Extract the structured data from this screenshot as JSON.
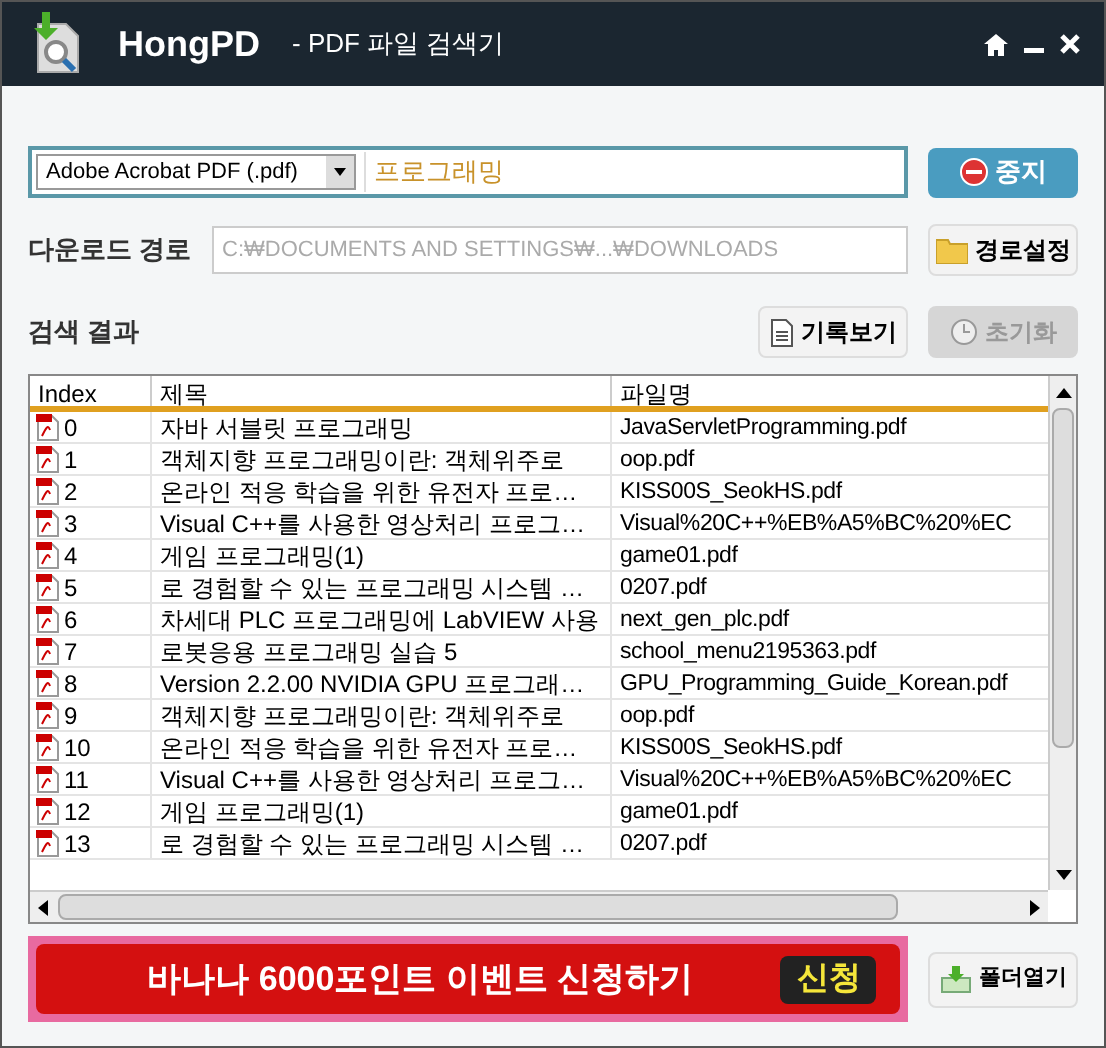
{
  "window": {
    "title": "HongPD",
    "subtitle": "- PDF 파일 검색기"
  },
  "search": {
    "file_type": "Adobe Acrobat PDF (.pdf)",
    "value": "프로그래밍",
    "stop_button": "중지"
  },
  "download_path": {
    "label": "다운로드 경로",
    "value": "C:₩DOCUMENTS AND SETTINGS₩...₩DOWNLOADS",
    "button": "경로설정"
  },
  "results": {
    "label": "검색 결과",
    "history_button": "기록보기",
    "reset_button": {
      "label": "초기화",
      "disabled": true
    }
  },
  "table": {
    "columns": [
      "Index",
      "제목",
      "파일명"
    ],
    "rows": [
      {
        "index": "0",
        "title": "자바 서블릿 프로그래밍",
        "file": "JavaServletProgramming.pdf"
      },
      {
        "index": "1",
        "title": "객체지향 프로그래밍이란: 객체위주로",
        "file": "oop.pdf"
      },
      {
        "index": "2",
        "title": "온라인 적응 학습을 위한 유전자 프로…",
        "file": "KISS00S_SeokHS.pdf"
      },
      {
        "index": "3",
        "title": "Visual C++를 사용한 영상처리 프로그…",
        "file": "Visual%20C++%EB%A5%BC%20%EC"
      },
      {
        "index": "4",
        "title": "게임 프로그래밍(1)",
        "file": "game01.pdf"
      },
      {
        "index": "5",
        "title": "로 경험할 수 있는 프로그래밍 시스템 …",
        "file": "0207.pdf"
      },
      {
        "index": "6",
        "title": "차세대 PLC 프로그래밍에 LabVIEW 사용",
        "file": "next_gen_plc.pdf"
      },
      {
        "index": "7",
        "title": "로봇응용 프로그래밍 실습 5",
        "file": "school_menu2195363.pdf"
      },
      {
        "index": "8",
        "title": "Version 2.2.00 NVIDIA GPU 프로그래…",
        "file": "GPU_Programming_Guide_Korean.pdf"
      },
      {
        "index": "9",
        "title": "객체지향 프로그래밍이란: 객체위주로",
        "file": "oop.pdf"
      },
      {
        "index": "10",
        "title": "온라인 적응 학습을 위한 유전자 프로…",
        "file": "KISS00S_SeokHS.pdf"
      },
      {
        "index": "11",
        "title": "Visual C++를 사용한 영상처리 프로그…",
        "file": "Visual%20C++%EB%A5%BC%20%EC"
      },
      {
        "index": "12",
        "title": "게임 프로그래밍(1)",
        "file": "game01.pdf"
      },
      {
        "index": "13",
        "title": "로 경험할 수 있는 프로그래밍 시스템 …",
        "file": "0207.pdf"
      }
    ]
  },
  "banner": {
    "text": "바나나 6000포인트 이벤트 신청하기",
    "button": "신청"
  },
  "open_folder_button": "폴더열기"
}
